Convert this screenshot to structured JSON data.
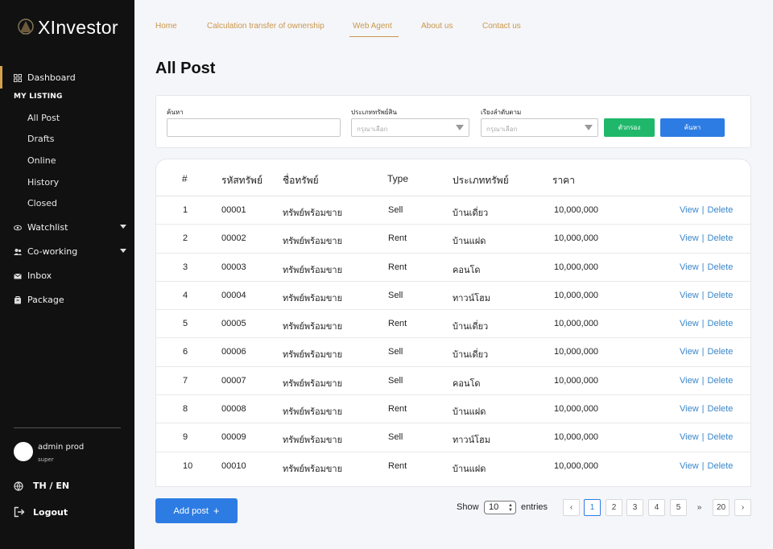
{
  "app": {
    "brand": "XInvestor"
  },
  "colors": {
    "accent": "#c9974a",
    "primary": "#2d7ce3",
    "success": "#1fb86b",
    "sidebar": "#111111",
    "link": "#3a86c9"
  },
  "sidebar": {
    "dashboard": "Dashboard",
    "my_listing_heading": "MY LISTING",
    "listing_items": [
      "All Post",
      "Drafts",
      "Online",
      "History",
      "Closed"
    ],
    "watchlist": "Watchlist",
    "coworking": "Co-working",
    "inbox": "Inbox",
    "package": "Package",
    "user_name": "admin prod",
    "user_role": "super",
    "language": "TH / EN",
    "logout": "Logout"
  },
  "topnav": [
    "Home",
    "Calculation transfer of ownership",
    "Web Agent",
    "About us",
    "Contact us"
  ],
  "page_title": "All Post",
  "filters": {
    "search_label": "ค้นหา",
    "search_value": "",
    "property_type_label": "ประเภททรัพย์สิน",
    "property_type_placeholder": "กรุณาเลือก",
    "sort_label": "เรียงลำดับตาม",
    "sort_placeholder": "กรุณาเลือก",
    "filter_button": "ตัวกรอง",
    "search_button": "ค้นหา"
  },
  "table": {
    "headers": [
      "#",
      "รหัสทรัพย์",
      "ชื่อทรัพย์",
      "Type",
      "ประเภททรัพย์",
      "ราคา"
    ],
    "view_label": "View",
    "delete_label": "Delete",
    "separator": "|",
    "rows": [
      [
        "1",
        "00001",
        "ทรัพย์พร้อมขาย",
        "Sell",
        "บ้านเดี่ยว",
        "10,000,000"
      ],
      [
        "2",
        "00002",
        "ทรัพย์พร้อมขาย",
        "Rent",
        "บ้านแฝด",
        "10,000,000"
      ],
      [
        "3",
        "00003",
        "ทรัพย์พร้อมขาย",
        "Rent",
        "คอนโด",
        "10,000,000"
      ],
      [
        "4",
        "00004",
        "ทรัพย์พร้อมขาย",
        "Sell",
        "ทาวน์โฮม",
        "10,000,000"
      ],
      [
        "5",
        "00005",
        "ทรัพย์พร้อมขาย",
        "Rent",
        "บ้านเดี่ยว",
        "10,000,000"
      ],
      [
        "6",
        "00006",
        "ทรัพย์พร้อมขาย",
        "Sell",
        "บ้านเดี่ยว",
        "10,000,000"
      ],
      [
        "7",
        "00007",
        "ทรัพย์พร้อมขาย",
        "Sell",
        "คอนโด",
        "10,000,000"
      ],
      [
        "8",
        "00008",
        "ทรัพย์พร้อมขาย",
        "Rent",
        "บ้านแฝด",
        "10,000,000"
      ],
      [
        "9",
        "00009",
        "ทรัพย์พร้อมขาย",
        "Sell",
        "ทาวน์โฮม",
        "10,000,000"
      ],
      [
        "10",
        "00010",
        "ทรัพย์พร้อมขาย",
        "Rent",
        "บ้านแฝด",
        "10,000,000"
      ]
    ]
  },
  "bottom": {
    "add_post": "Add post",
    "add_icon": "+",
    "show_label": "Show",
    "entries_value": "10",
    "entries_label": "entries"
  },
  "pagination": {
    "prev": "‹",
    "pages": [
      "1",
      "2",
      "3",
      "4",
      "5"
    ],
    "active_page": "1",
    "jump": "»",
    "last": "20",
    "next": "›"
  }
}
